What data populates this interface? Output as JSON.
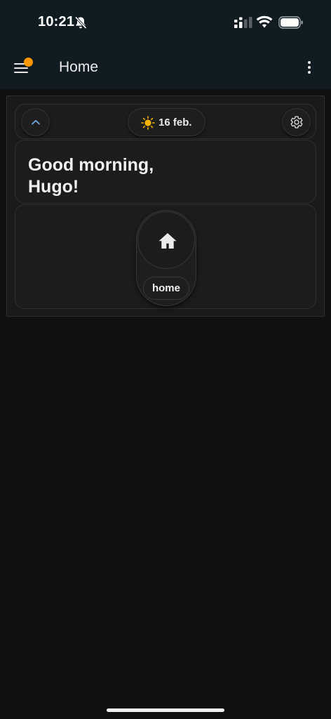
{
  "status_bar": {
    "time": "10:21",
    "icons": [
      "bell-muted-icon",
      "signal-icon",
      "wifi-icon",
      "battery-icon"
    ]
  },
  "app_bar": {
    "title": "Home",
    "menu_icon": "menu-icon",
    "badge_color": "#ff9800",
    "overflow_icon": "more-vert-icon"
  },
  "dashboard": {
    "chips": {
      "collapse_icon": "chevron-up-icon",
      "weather_icon": "sun-icon",
      "date": "16 feb.",
      "settings_icon": "gear-icon"
    },
    "greeting": {
      "line1": "Good morning,",
      "line2": "Hugo!"
    },
    "rooms": [
      {
        "icon": "home-icon",
        "label": "home"
      }
    ]
  },
  "colors": {
    "accent_blue": "#6fa8dc",
    "sun": "#f5b400"
  }
}
